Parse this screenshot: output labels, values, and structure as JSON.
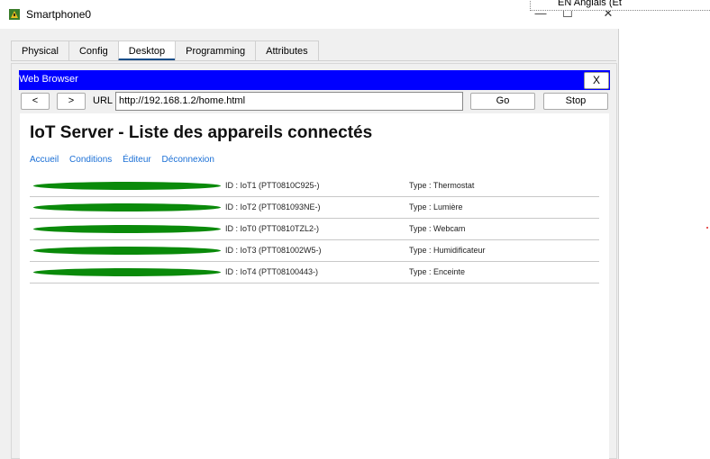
{
  "window": {
    "title": "Smartphone0",
    "minimize": "—",
    "maximize": "☐",
    "close": "✕"
  },
  "language_popup": {
    "text": "EN Anglais (Et"
  },
  "tabs": [
    {
      "label": "Physical"
    },
    {
      "label": "Config"
    },
    {
      "label": "Desktop",
      "active": true
    },
    {
      "label": "Programming"
    },
    {
      "label": "Attributes"
    }
  ],
  "browser": {
    "title": "Web Browser",
    "close_label": "X",
    "back_label": "<",
    "forward_label": ">",
    "url_label": "URL",
    "url": "http://192.168.1.2/home.html",
    "go_label": "Go",
    "stop_label": "Stop",
    "bar_color": "#0000ff"
  },
  "page": {
    "title": "IoT Server - Liste des appareils connectés",
    "links": [
      "Accueil",
      "Conditions",
      "Éditeur",
      "Déconnexion"
    ],
    "status_color": "#0a8a0a",
    "devices": [
      {
        "id": "ID : IoT1 (PTT0810C925-)",
        "type": "Type : Thermostat"
      },
      {
        "id": "ID : IoT2 (PTT081093NE-)",
        "type": "Type : Lumière"
      },
      {
        "id": "ID : IoT0 (PTT0810TZL2-)",
        "type": "Type : Webcam"
      },
      {
        "id": "ID : IoT3 (PTT081002W5-)",
        "type": "Type : Humidificateur"
      },
      {
        "id": "ID : IoT4 (PTT08100443-)",
        "type": "Type : Enceinte"
      }
    ]
  }
}
